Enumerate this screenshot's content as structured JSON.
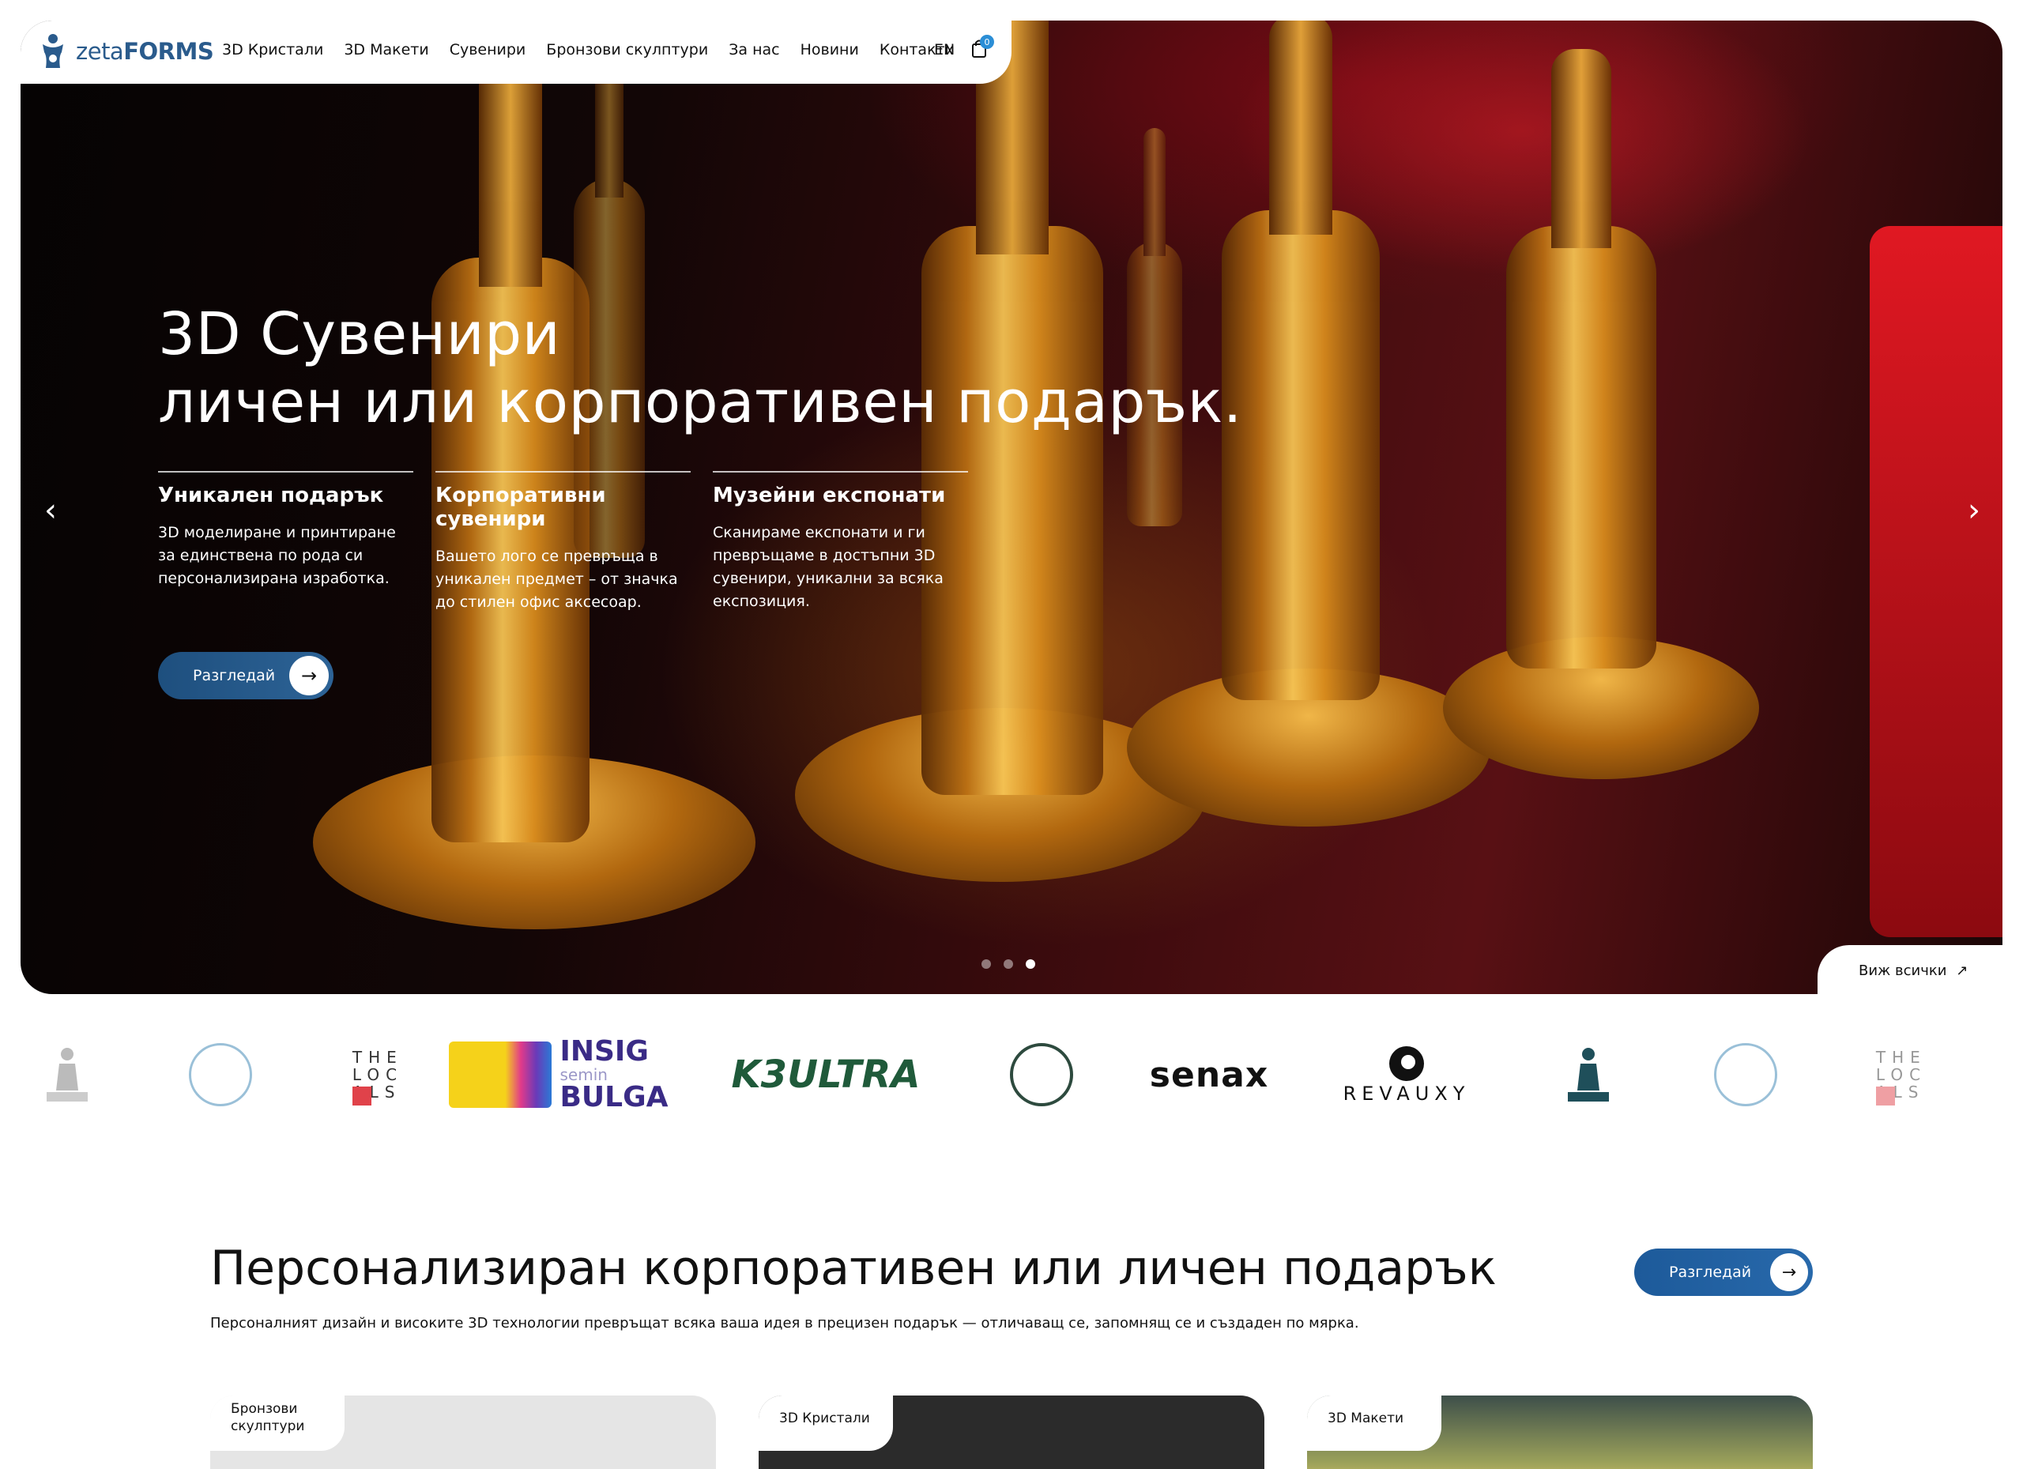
{
  "header": {
    "logo_text": "zetaFORMS",
    "nav": [
      "3D Кристали",
      "3D Макети",
      "Сувенири",
      "Бронзови скулптури",
      "За нас",
      "Новини",
      "Контакти"
    ],
    "lang": "EN",
    "cart_count": "0"
  },
  "hero": {
    "title_line1": "3D Сувенири",
    "title_line2": "личен или корпоративен подарък.",
    "features": [
      {
        "title": "Уникален подарък",
        "text": "3D моделиране и принтиране за единствена по рода си персонализирана изработка."
      },
      {
        "title": "Корпоративни сувенири",
        "text": "Вашето лого се превръща в уникален предмет – от значка до стилен офис аксесоар."
      },
      {
        "title": "Музейни експонати",
        "text": "Сканираме експонати и ги превръщаме в достъпни 3D сувенири, уникални за всяка експозиция."
      }
    ],
    "button_label": "Разгледай",
    "view_all": "Виж всички",
    "slides_total": 3,
    "active_slide": 3
  },
  "clients": {
    "locals": [
      "THE",
      "LOC",
      "ALS"
    ],
    "insig_line1": "INSIG",
    "insig_line2": "semin",
    "insig_line3": "BULGA",
    "k3": "K3ULTRA",
    "senax": "senax",
    "revauxy": "REVAUXY"
  },
  "section": {
    "title": "Персонализиран корпоративен или личен подарък",
    "subtitle": "Персоналният дизайн и високите 3D технологии превръщат всяка ваша идея в прецизен подарък — отличаващ се, запомнящ се и създаден по мярка.",
    "button_label": "Разгледай",
    "cards": [
      {
        "label_line1": "Бронзови",
        "label_line2": "скулптури"
      },
      {
        "label_line1": "3D Кристали",
        "label_line2": ""
      },
      {
        "label_line1": "3D Макети",
        "label_line2": ""
      }
    ]
  },
  "colors": {
    "brand_blue": "#2a5b8c",
    "button_gradient_start": "#1e4f7e",
    "accent_red": "#e01822"
  }
}
